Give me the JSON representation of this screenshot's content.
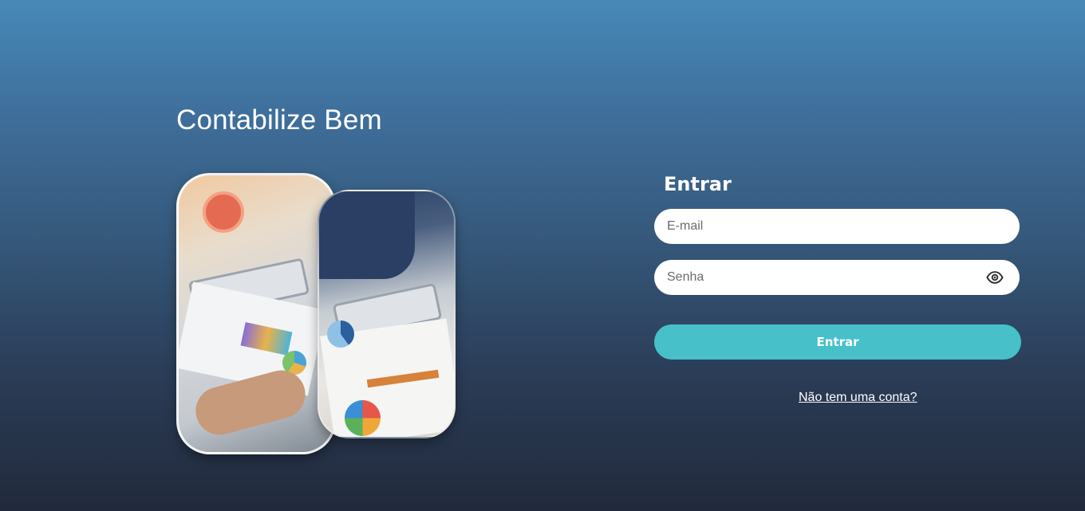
{
  "brand": {
    "title": "Contabilize Bem"
  },
  "images": {
    "left": "business-documents-photo",
    "right": "team-meeting-charts-photo"
  },
  "login": {
    "title": "Entrar",
    "email_placeholder": "E-mail",
    "password_placeholder": "Senha",
    "password_toggle_icon": "eye-icon",
    "submit_label": "Entrar",
    "signup_link": "Não tem uma conta?"
  },
  "colors": {
    "accent": "#47c0ca",
    "bg_top": "#4689b8",
    "bg_bottom": "#212a3c"
  }
}
